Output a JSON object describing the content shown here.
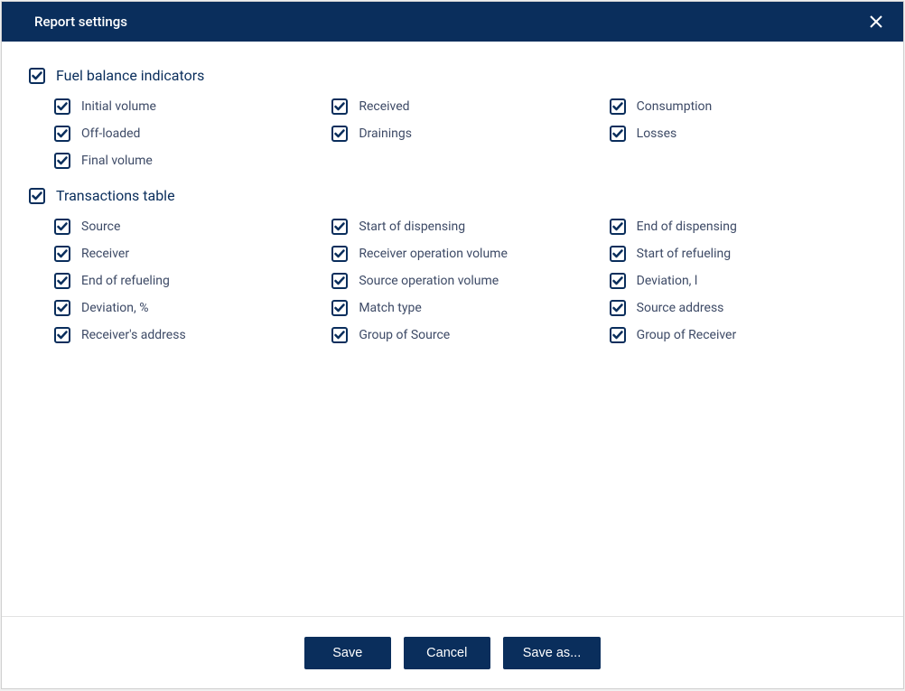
{
  "dialog": {
    "title": "Report settings"
  },
  "sections": {
    "fuelBalance": {
      "title": "Fuel balance indicators",
      "items": [
        "Initial volume",
        "Received",
        "Consumption",
        "Off-loaded",
        "Drainings",
        "Losses",
        "Final volume"
      ]
    },
    "transactions": {
      "title": "Transactions table",
      "items": [
        "Source",
        "Start of dispensing",
        "End of dispensing",
        "Receiver",
        "Receiver operation volume",
        "Start of refueling",
        "End of refueling",
        "Source operation volume",
        "Deviation, l",
        "Deviation, %",
        "Match type",
        "Source address",
        "Receiver's address",
        "Group of Source",
        "Group of Receiver"
      ]
    }
  },
  "footer": {
    "save": "Save",
    "cancel": "Cancel",
    "saveAs": "Save as..."
  }
}
